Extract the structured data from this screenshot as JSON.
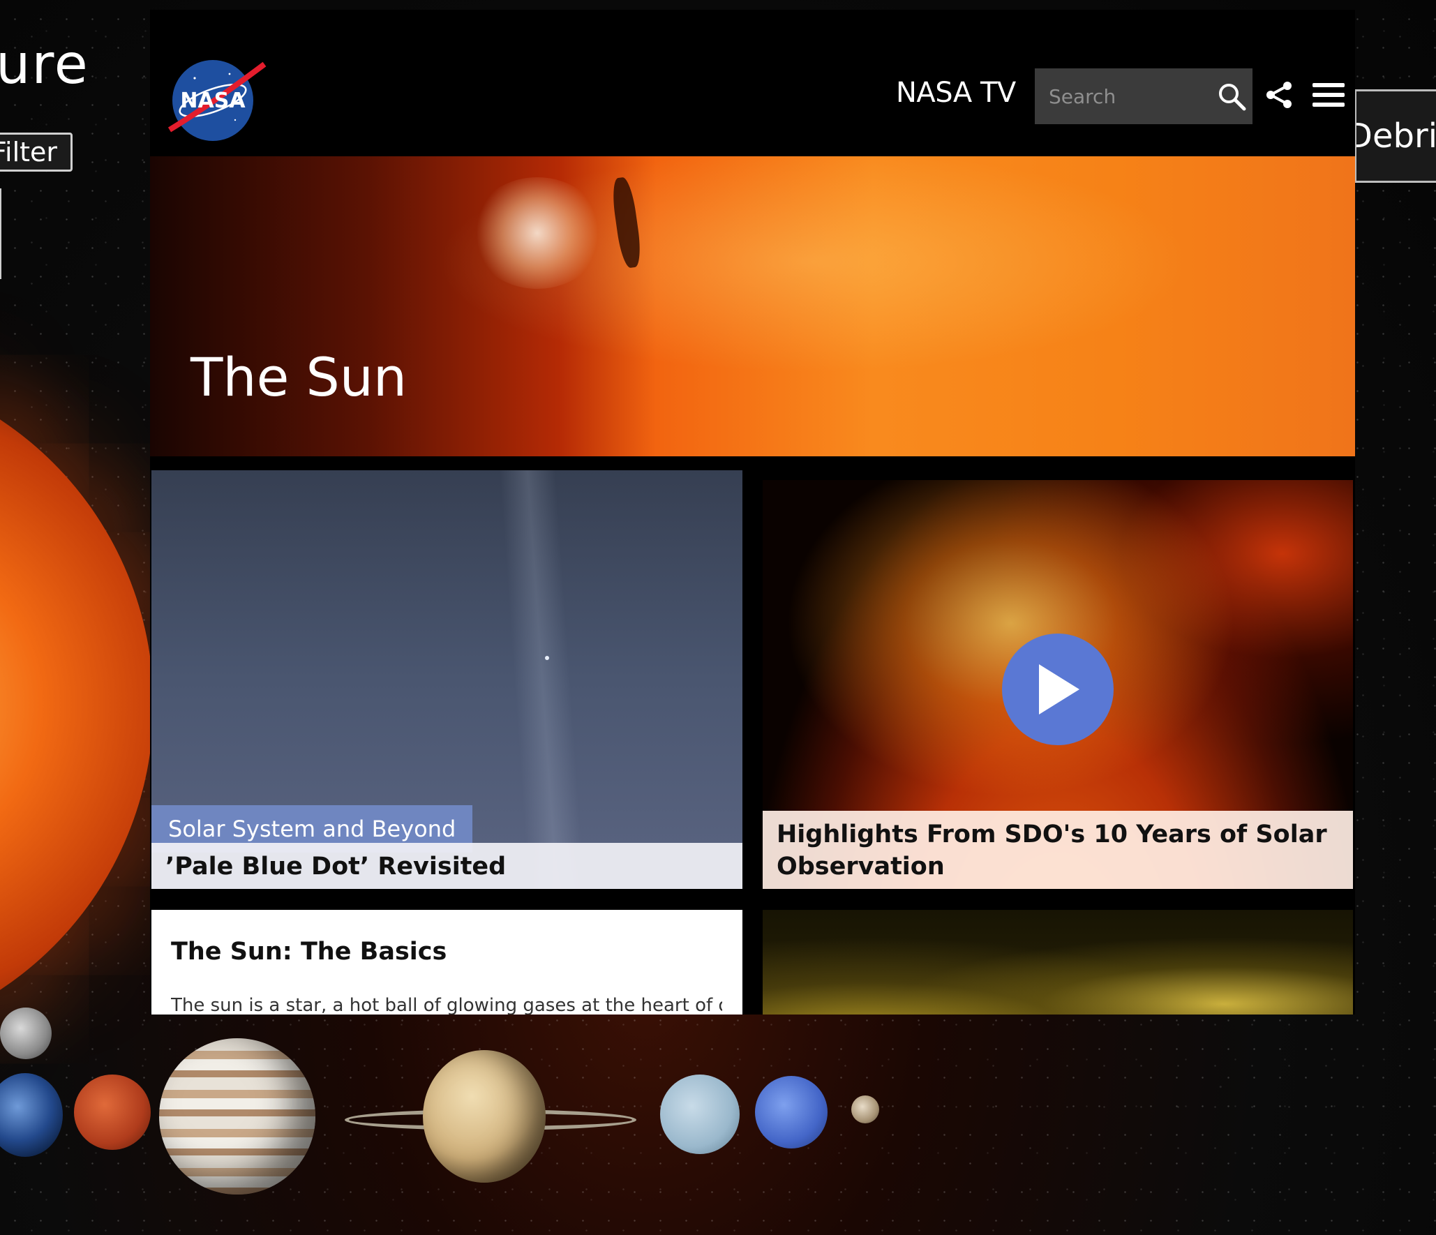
{
  "app": {
    "title_fragment": "ure",
    "filter_label": "Filter",
    "debris_label": "Debris"
  },
  "nasa_page": {
    "logo_text": "NASA",
    "nav": {
      "tv_label": "NASA TV"
    },
    "search": {
      "placeholder": "Search",
      "icon": "search-icon"
    },
    "share_icon": "share-icon",
    "menu_icon": "menu-icon",
    "hero": {
      "title": "The Sun"
    },
    "cards": [
      {
        "category": "Solar System and Beyond",
        "title": "’Pale Blue Dot’ Revisited"
      },
      {
        "title": "Highlights From SDO's 10 Years of Solar Observation",
        "has_video": true
      },
      {
        "title": "The Sun: The Basics",
        "excerpt": "The sun is a star, a hot ball of glowing gases at the heart of our"
      }
    ],
    "colors": {
      "category_tag": "#6f86c0",
      "play_button": "#5a78d4",
      "search_box": "#3b3b3b"
    }
  }
}
